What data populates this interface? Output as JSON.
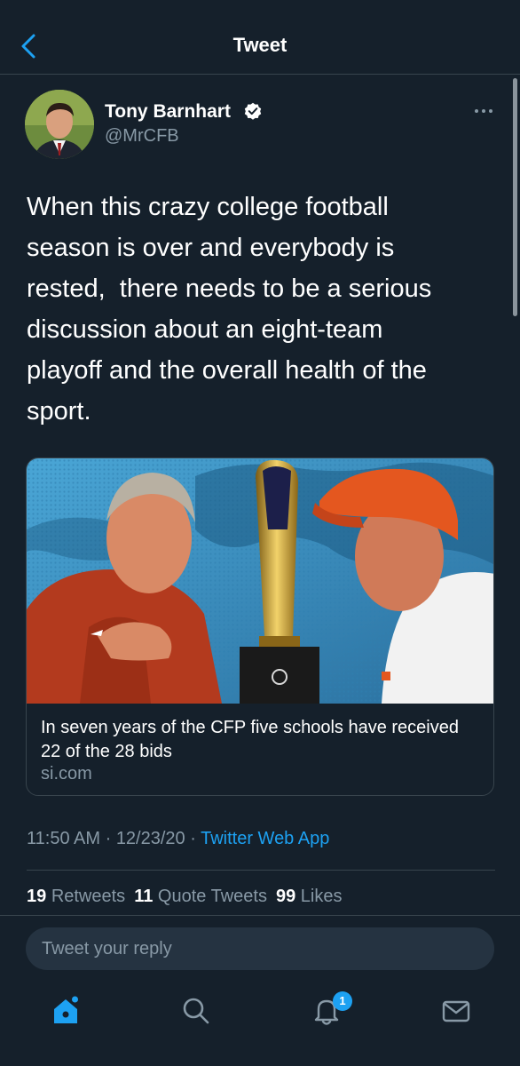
{
  "header": {
    "title": "Tweet"
  },
  "author": {
    "name": "Tony Barnhart",
    "handle": "@MrCFB",
    "verified": true
  },
  "tweet": {
    "text": "When this crazy college football\nseason is over and everybody is\nrested,  there needs to be a serious\ndiscussion about an eight-team\nplayoff and the overall health of the\nsport."
  },
  "card": {
    "title": "In seven years of the CFP five schools have received 22 of the 28 bids",
    "domain": "si.com"
  },
  "meta": {
    "time": "11:50 AM",
    "sep1": " · ",
    "date": "12/23/20",
    "sep2": " · ",
    "app": "Twitter Web App"
  },
  "stats": {
    "retweets_count": "19",
    "retweets_label": "Retweets",
    "quotes_count": "11",
    "quotes_label": "Quote Tweets",
    "likes_count": "99",
    "likes_label": "Likes"
  },
  "reply": {
    "placeholder": "Tweet your reply"
  },
  "tabbar": {
    "notifications_badge": "1"
  },
  "colors": {
    "background": "#15202b",
    "accent": "#1da1f2",
    "secondary_text": "#8899a6",
    "divider": "#38444d"
  }
}
